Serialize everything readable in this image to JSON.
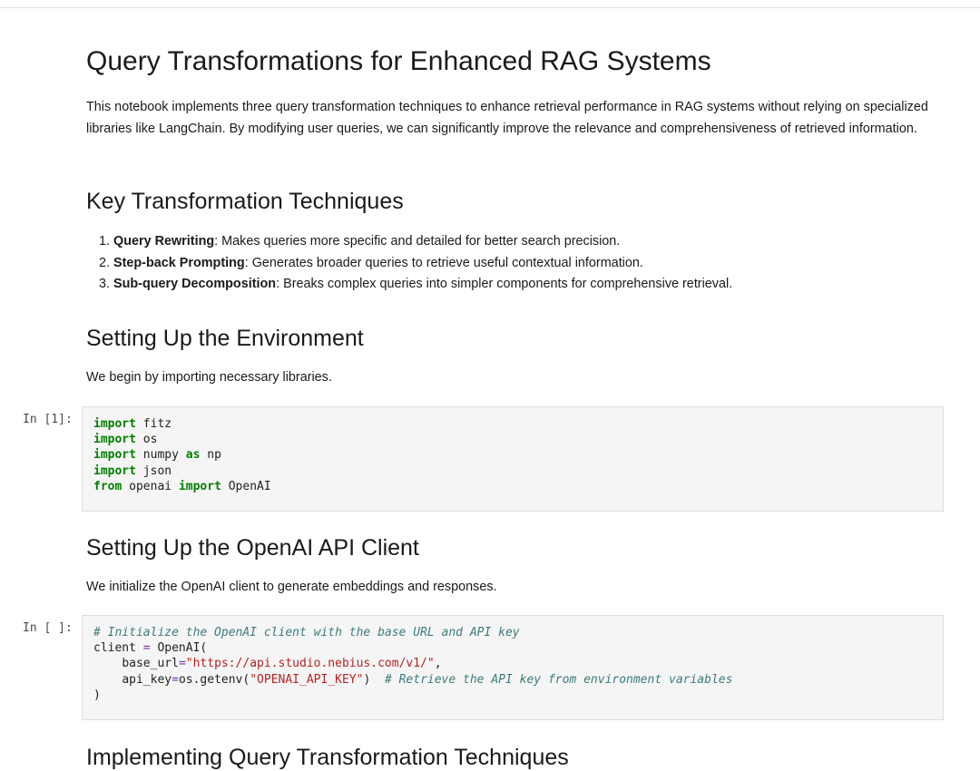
{
  "title": "Query Transformations for Enhanced RAG Systems",
  "intro": "This notebook implements three query transformation techniques to enhance retrieval performance in RAG systems without relying on specialized libraries like LangChain. By modifying user queries, we can significantly improve the relevance and comprehensiveness of retrieved information.",
  "key_techniques": {
    "heading": "Key Transformation Techniques",
    "items": [
      {
        "bold": "Query Rewriting",
        "text": ": Makes queries more specific and detailed for better search precision."
      },
      {
        "bold": "Step-back Prompting",
        "text": ": Generates broader queries to retrieve useful contextual information."
      },
      {
        "bold": "Sub-query Decomposition",
        "text": ": Breaks complex queries into simpler components for comprehensive retrieval."
      }
    ]
  },
  "setup_env": {
    "heading": "Setting Up the Environment",
    "text": "We begin by importing necessary libraries."
  },
  "cell1": {
    "prompt": "In [1]:",
    "lines": [
      {
        "kw": "import",
        "rest": " fitz"
      },
      {
        "kw": "import",
        "rest": " os"
      },
      {
        "kw": "import",
        "mid": " numpy ",
        "kw2": "as",
        "rest": " np"
      },
      {
        "kw": "import",
        "rest": " json"
      },
      {
        "kw": "from",
        "mid": " openai ",
        "kw2": "import",
        "rest": " OpenAI"
      }
    ]
  },
  "setup_client": {
    "heading": "Setting Up the OpenAI API Client",
    "text": "We initialize the OpenAI client to generate embeddings and responses."
  },
  "cell2": {
    "prompt": "In [ ]:",
    "comment1": "# Initialize the OpenAI client with the base URL and API key",
    "client_var": "client ",
    "eq": "=",
    "client_call": " OpenAI(",
    "base_indent": "    ",
    "base_key": "base_url",
    "base_value": "\"https://api.studio.nebius.com/v1/\"",
    "comma": ",",
    "api_key": "api_key",
    "api_call": "os.getenv(",
    "api_value": "\"OPENAI_API_KEY\"",
    "api_close": ")",
    "comment2": "# Retrieve the API key from environment variables",
    "close": ")"
  },
  "next_heading": "Implementing Query Transformation Techniques",
  "colors": {
    "keyword": "#008000",
    "string": "#ba2121",
    "comment": "#3d7b7b",
    "cell_bg": "#f5f5f5"
  }
}
